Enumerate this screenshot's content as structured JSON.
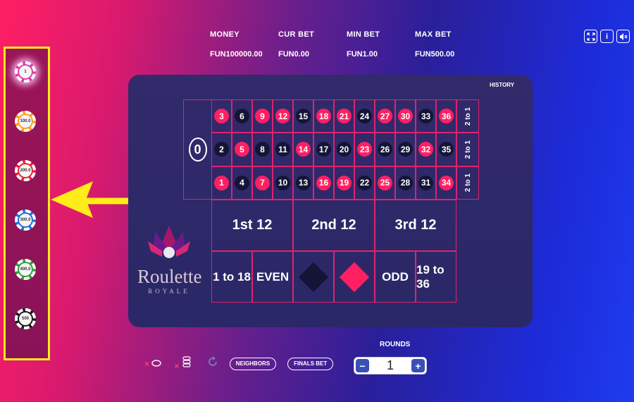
{
  "stats": [
    {
      "label": "MONEY",
      "value": "FUN100000.00"
    },
    {
      "label": "CUR BET",
      "value": "FUN0.00"
    },
    {
      "label": "MIN BET",
      "value": "FUN1.00"
    },
    {
      "label": "MAX BET",
      "value": "FUN500.00"
    }
  ],
  "top_icons": [
    "fullscreen-icon",
    "info-icon",
    "mute-icon"
  ],
  "info_glyph": "i",
  "chips": [
    {
      "label": "1",
      "color": "#e23aa8",
      "selected": true
    },
    {
      "label": "100.0",
      "color": "#ff9b22"
    },
    {
      "label": "200.0",
      "color": "#e8223a"
    },
    {
      "label": "300.0",
      "color": "#1f6ed9"
    },
    {
      "label": "400.0",
      "color": "#2f9d3a"
    },
    {
      "label": "500",
      "color": "#1a1a1a"
    }
  ],
  "history_label": "HISTORY",
  "zero": "0",
  "rows": [
    [
      {
        "n": "3",
        "c": "red"
      },
      {
        "n": "6",
        "c": "black"
      },
      {
        "n": "9",
        "c": "red"
      },
      {
        "n": "12",
        "c": "red"
      },
      {
        "n": "15",
        "c": "black"
      },
      {
        "n": "18",
        "c": "red"
      },
      {
        "n": "21",
        "c": "red"
      },
      {
        "n": "24",
        "c": "black"
      },
      {
        "n": "27",
        "c": "red"
      },
      {
        "n": "30",
        "c": "red"
      },
      {
        "n": "33",
        "c": "black"
      },
      {
        "n": "36",
        "c": "red"
      }
    ],
    [
      {
        "n": "2",
        "c": "black"
      },
      {
        "n": "5",
        "c": "red"
      },
      {
        "n": "8",
        "c": "black"
      },
      {
        "n": "11",
        "c": "black"
      },
      {
        "n": "14",
        "c": "red"
      },
      {
        "n": "17",
        "c": "black"
      },
      {
        "n": "20",
        "c": "black"
      },
      {
        "n": "23",
        "c": "red"
      },
      {
        "n": "26",
        "c": "black"
      },
      {
        "n": "29",
        "c": "black"
      },
      {
        "n": "32",
        "c": "red"
      },
      {
        "n": "35",
        "c": "black"
      }
    ],
    [
      {
        "n": "1",
        "c": "red"
      },
      {
        "n": "4",
        "c": "black"
      },
      {
        "n": "7",
        "c": "red"
      },
      {
        "n": "10",
        "c": "black"
      },
      {
        "n": "13",
        "c": "black"
      },
      {
        "n": "16",
        "c": "red"
      },
      {
        "n": "19",
        "c": "red"
      },
      {
        "n": "22",
        "c": "black"
      },
      {
        "n": "25",
        "c": "red"
      },
      {
        "n": "28",
        "c": "black"
      },
      {
        "n": "31",
        "c": "black"
      },
      {
        "n": "34",
        "c": "red"
      }
    ]
  ],
  "column_bet": "2 to 1",
  "dozens": [
    "1st 12",
    "2nd 12",
    "3rd 12"
  ],
  "outside": [
    "1 to 18",
    "EVEN",
    "",
    "",
    "ODD",
    "19 to 36"
  ],
  "colors": {
    "red": "#ff1f63",
    "black": "#141536",
    "border": "#e0226e",
    "highlight": "#ffec1a"
  },
  "logo": {
    "name": "Roulette",
    "sub": "ROYALE"
  },
  "bottom": {
    "neighbors": "NEIGHBORS",
    "finals": "FINALS BET",
    "clear_mark": "×"
  },
  "rounds": {
    "label": "ROUNDS",
    "value": "1",
    "minus": "−",
    "plus": "+"
  }
}
